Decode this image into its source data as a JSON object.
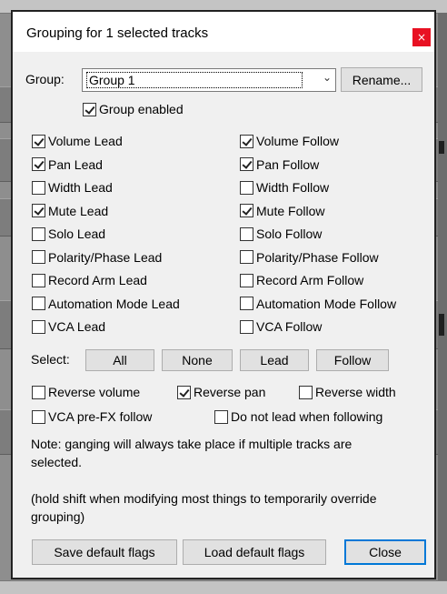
{
  "dialog": {
    "title": "Grouping for 1 selected tracks",
    "close_glyph": "×"
  },
  "group": {
    "label": "Group:",
    "selected": "Group 1",
    "rename_label": "Rename...",
    "enabled_label": "Group enabled",
    "enabled_checked": true
  },
  "lead": [
    {
      "label": "Volume Lead",
      "checked": true
    },
    {
      "label": "Pan Lead",
      "checked": true
    },
    {
      "label": "Width Lead",
      "checked": false
    },
    {
      "label": "Mute Lead",
      "checked": true
    },
    {
      "label": "Solo Lead",
      "checked": false
    },
    {
      "label": "Polarity/Phase Lead",
      "checked": false
    },
    {
      "label": "Record Arm Lead",
      "checked": false
    },
    {
      "label": "Automation Mode Lead",
      "checked": false
    },
    {
      "label": "VCA Lead",
      "checked": false
    }
  ],
  "follow": [
    {
      "label": "Volume Follow",
      "checked": true
    },
    {
      "label": "Pan Follow",
      "checked": true
    },
    {
      "label": "Width Follow",
      "checked": false
    },
    {
      "label": "Mute Follow",
      "checked": true
    },
    {
      "label": "Solo Follow",
      "checked": false
    },
    {
      "label": "Polarity/Phase Follow",
      "checked": false
    },
    {
      "label": "Record Arm Follow",
      "checked": false
    },
    {
      "label": "Automation Mode Follow",
      "checked": false
    },
    {
      "label": "VCA Follow",
      "checked": false
    }
  ],
  "select_row": {
    "label": "Select:",
    "all": "All",
    "none": "None",
    "lead": "Lead",
    "follow": "Follow"
  },
  "options": {
    "reverse_volume": {
      "label": "Reverse volume",
      "checked": false
    },
    "reverse_pan": {
      "label": "Reverse pan",
      "checked": true
    },
    "reverse_width": {
      "label": "Reverse width",
      "checked": false
    },
    "vca_prefx": {
      "label": "VCA pre-FX follow",
      "checked": false
    },
    "no_lead": {
      "label": "Do not lead when following",
      "checked": false
    }
  },
  "notes": {
    "line1": "Note: ganging will always take place if multiple tracks are",
    "line2": "selected.",
    "line3": "(hold shift when modifying most things to temporarily override",
    "line4": "grouping)"
  },
  "footer": {
    "save": "Save default flags",
    "load": "Load default flags",
    "close": "Close"
  }
}
